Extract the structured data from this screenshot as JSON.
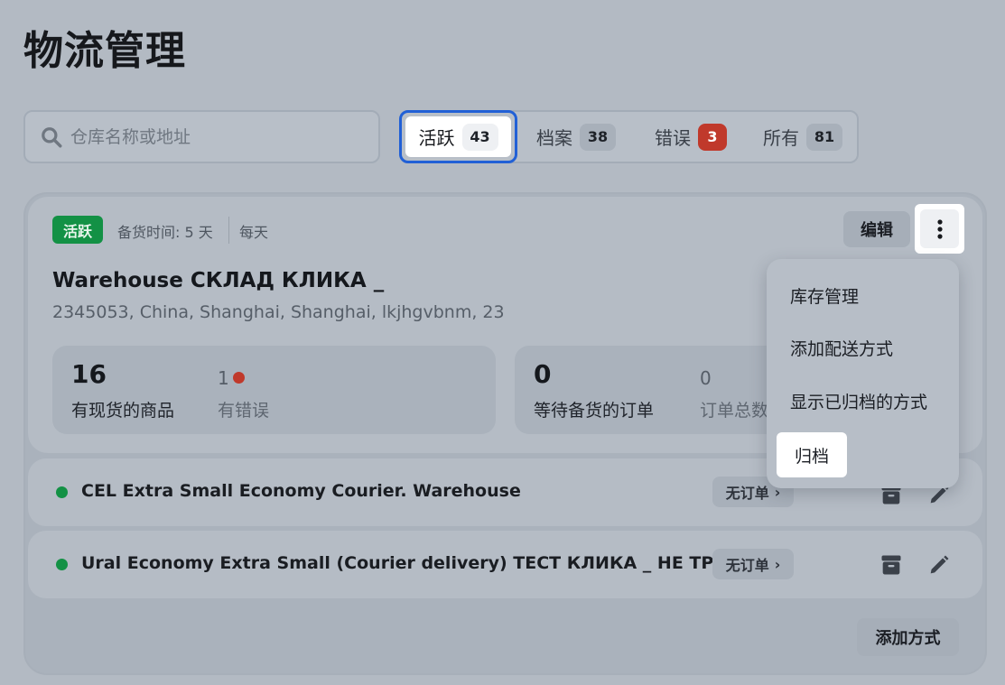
{
  "page": {
    "title": "物流管理"
  },
  "search": {
    "placeholder": "仓库名称或地址"
  },
  "tabs": [
    {
      "label": "活跃",
      "count": "43",
      "active": true
    },
    {
      "label": "档案",
      "count": "38"
    },
    {
      "label": "错误",
      "count": "3"
    },
    {
      "label": "所有",
      "count": "81"
    }
  ],
  "warehouse": {
    "status": "活跃",
    "prep_time": "备货时间: 5 天",
    "frequency": "每天",
    "edit_label": "编辑",
    "name": "Warehouse СКЛАД КЛИКА _",
    "address": "2345053, China, Shanghai, Shanghai, lkjhgvbnm, 23",
    "stats": {
      "products_in_stock": {
        "value": "16",
        "label": "有现货的商品"
      },
      "with_errors": {
        "value": "1",
        "label": "有错误"
      },
      "awaiting_orders": {
        "value": "0",
        "label": "等待备货的订单"
      },
      "total_orders": {
        "value": "0",
        "label": "订单总数"
      }
    }
  },
  "methods": [
    {
      "name": "CEL Extra Small Economy Courier. Warehouse",
      "orders": "无订单"
    },
    {
      "name": "Ural Economy Extra Small (Courier delivery) ТЕСТ КЛИКА _ НЕ ТРОГА...",
      "orders": "无订单"
    }
  ],
  "add_method_label": "添加方式",
  "menu": {
    "items": [
      "库存管理",
      "添加配送方式",
      "显示已归档的方式",
      "归档"
    ]
  },
  "colors": {
    "accent": "#2160d6",
    "success": "#139145",
    "error": "#c0392b"
  }
}
